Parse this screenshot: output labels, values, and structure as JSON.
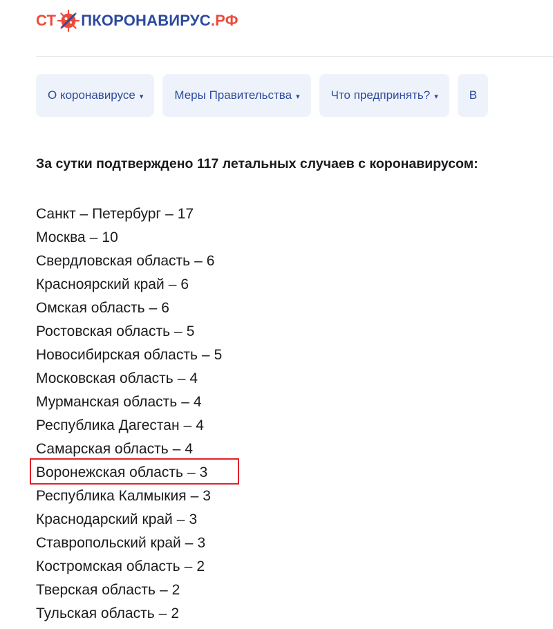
{
  "logo": {
    "part_red_1": "СТ",
    "part_blue": "ПКОРОНАВИРУС",
    "part_red_2": ".РФ"
  },
  "colors": {
    "brand_red": "#ec4b3b",
    "brand_blue": "#2d4a9c",
    "nav_bg": "#eef3fb",
    "highlight_border": "#e0202a"
  },
  "nav": [
    {
      "label": "О коронавирусе",
      "icon": "caret-down-icon"
    },
    {
      "label": "Меры Правительства",
      "icon": "caret-down-icon"
    },
    {
      "label": "Что предпринять?",
      "icon": "caret-down-icon"
    },
    {
      "label": "В"
    }
  ],
  "caret": "▾",
  "headline": "За сутки подтверждено 117 летальных случаев с коронавирусом:",
  "separator": "–",
  "regions": [
    {
      "name": "Санкт – Петербург",
      "count": "17"
    },
    {
      "name": "Москва",
      "count": "10"
    },
    {
      "name": "Свердловская область",
      "count": "6"
    },
    {
      "name": "Красноярский край",
      "count": "6"
    },
    {
      "name": "Омская область",
      "count": "6"
    },
    {
      "name": "Ростовская область",
      "count": "5"
    },
    {
      "name": "Новосибирская область",
      "count": "5"
    },
    {
      "name": "Московская область",
      "count": "4"
    },
    {
      "name": "Мурманская область",
      "count": "4"
    },
    {
      "name": "Республика Дагестан",
      "count": "4"
    },
    {
      "name": "Самарская область",
      "count": "4"
    },
    {
      "name": "Воронежская область",
      "count": "3",
      "highlighted": true
    },
    {
      "name": "Республика Калмыкия",
      "count": "3"
    },
    {
      "name": "Краснодарский край",
      "count": "3"
    },
    {
      "name": "Ставропольский край",
      "count": "3"
    },
    {
      "name": "Костромская область",
      "count": "2"
    },
    {
      "name": "Тверская область",
      "count": "2"
    },
    {
      "name": "Тульская область",
      "count": "2"
    }
  ]
}
